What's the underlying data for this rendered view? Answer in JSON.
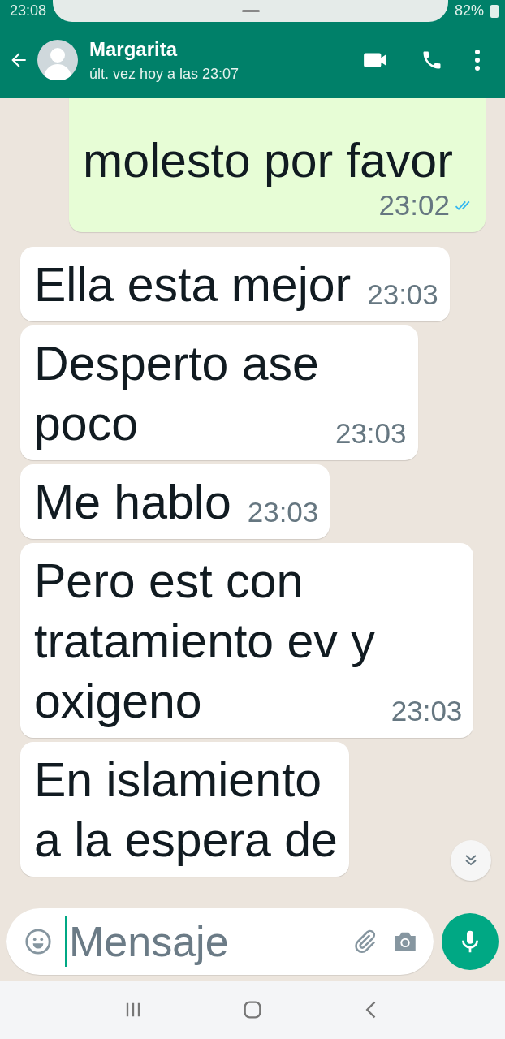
{
  "status_bar": {
    "time": "23:08",
    "battery": "82%"
  },
  "header": {
    "name": "Margarita",
    "last_seen": "últ. vez hoy a las 23:07"
  },
  "messages": [
    {
      "kind": "sent",
      "text": "molesto por favor",
      "time": "23:02",
      "read": true
    },
    {
      "kind": "received",
      "text": "Ella esta mejor",
      "time": "23:03"
    },
    {
      "kind": "received",
      "text": "Desperto ase\npoco",
      "time": "23:03"
    },
    {
      "kind": "received",
      "text": "Me hablo",
      "time": "23:03"
    },
    {
      "kind": "received",
      "text": "Pero est con\ntratamiento ev y\noxigeno",
      "time": "23:03"
    },
    {
      "kind": "received",
      "text": "En islamiento\na la espera de"
    }
  ],
  "composer": {
    "placeholder": "Mensaje"
  }
}
